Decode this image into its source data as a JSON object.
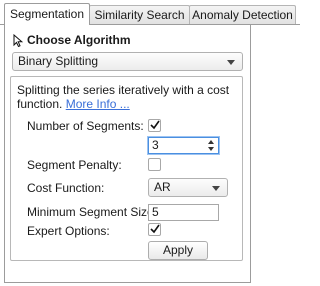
{
  "tabs": [
    {
      "label": "Segmentation",
      "active": true
    },
    {
      "label": "Similarity Search",
      "active": false
    },
    {
      "label": "Anomaly Detection",
      "active": false
    }
  ],
  "header": {
    "title": "Choose Algorithm",
    "icon": "cursor-arrow-icon"
  },
  "algorithm": {
    "selected": "Binary Splitting"
  },
  "description": {
    "text": "Splitting the series iteratively with a cost function.",
    "link": "More Info ..."
  },
  "options": {
    "num_segments": {
      "label": "Number of Segments:",
      "checked": true,
      "value": "3"
    },
    "segment_penalty": {
      "label": "Segment Penalty:",
      "checked": false
    },
    "cost_function": {
      "label": "Cost Function:",
      "selected": "AR"
    },
    "min_segment_size": {
      "label": "Minimum Segment Size:",
      "value": "5"
    },
    "expert_options": {
      "label": "Expert Options:",
      "checked": true
    }
  },
  "apply_label": "Apply",
  "colors": {
    "link": "#3a6fd8",
    "focus": "#4a8fe0"
  }
}
